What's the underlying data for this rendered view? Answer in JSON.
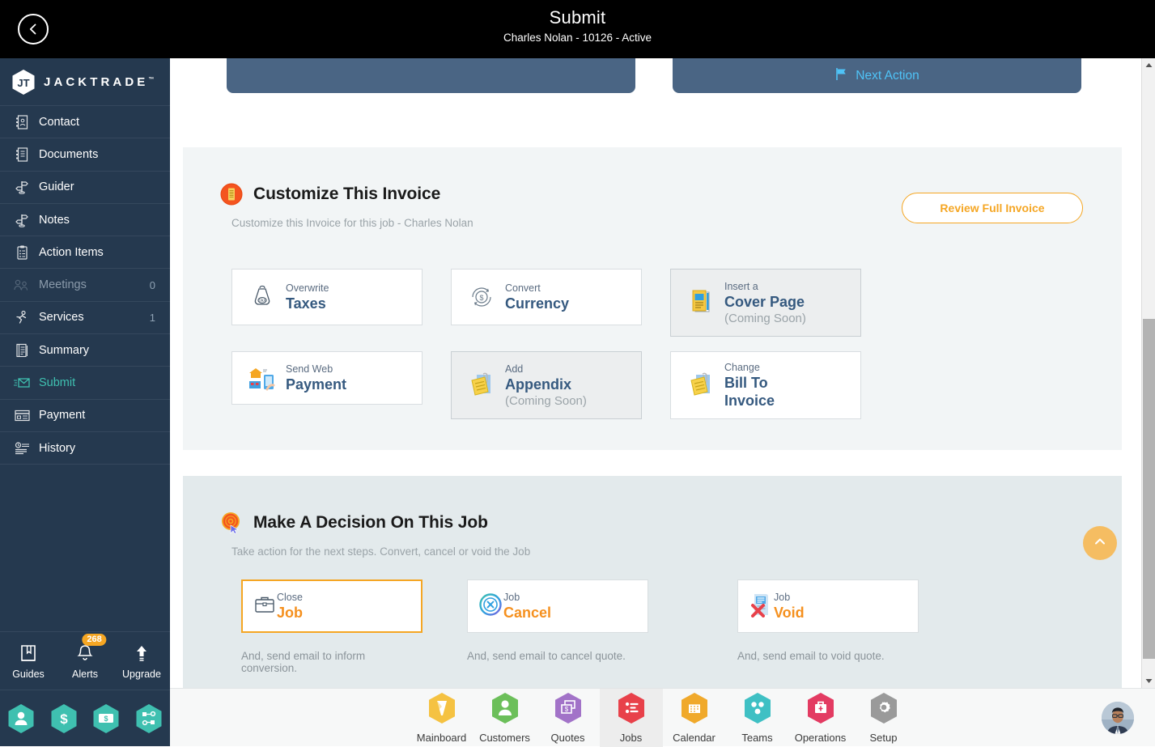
{
  "header": {
    "title": "Submit",
    "subtitle": "Charles Nolan - 10126 - Active",
    "back_icon": "chevron-left-icon"
  },
  "sidebar": {
    "brand": "JACKTRADE",
    "brand_tm": "™",
    "items": [
      {
        "label": "Contact",
        "icon": "contact-book-icon",
        "count": "",
        "state": "normal"
      },
      {
        "label": "Documents",
        "icon": "documents-icon",
        "count": "",
        "state": "normal"
      },
      {
        "label": "Guider",
        "icon": "signpost-icon",
        "count": "",
        "state": "normal"
      },
      {
        "label": "Notes",
        "icon": "signpost-icon",
        "count": "",
        "state": "normal"
      },
      {
        "label": "Action Items",
        "icon": "clipboard-icon",
        "count": "",
        "state": "normal"
      },
      {
        "label": "Meetings",
        "icon": "meetings-icon",
        "count": "0",
        "state": "dim"
      },
      {
        "label": "Services",
        "icon": "services-icon",
        "count": "1",
        "state": "normal"
      },
      {
        "label": "Summary",
        "icon": "summary-icon",
        "count": "",
        "state": "normal"
      },
      {
        "label": "Submit",
        "icon": "submit-mail-icon",
        "count": "",
        "state": "active"
      },
      {
        "label": "Payment",
        "icon": "payment-card-icon",
        "count": "",
        "state": "normal"
      },
      {
        "label": "History",
        "icon": "history-icon",
        "count": "",
        "state": "normal"
      }
    ],
    "footer": [
      {
        "label": "Guides",
        "icon": "book-icon",
        "badge": ""
      },
      {
        "label": "Alerts",
        "icon": "bell-icon",
        "badge": "268"
      },
      {
        "label": "Upgrade",
        "icon": "arrow-up-icon",
        "badge": ""
      }
    ],
    "quick_hexes": [
      {
        "icon": "person-hex-icon"
      },
      {
        "icon": "dollar-hex-icon"
      },
      {
        "icon": "money-hex-icon"
      },
      {
        "icon": "network-hex-icon"
      }
    ]
  },
  "top_strip": {
    "next_action_label": "Next Action",
    "flag_icon": "flag-icon"
  },
  "customize": {
    "icon": "orange-invoice-icon",
    "title": "Customize This Invoice",
    "subtitle": "Customize this Invoice for this job - Charles Nolan",
    "review_button": "Review Full Invoice",
    "cards": [
      {
        "small": "Overwrite",
        "big": "Taxes",
        "note": "",
        "icon": "tax-bag-icon",
        "disabled": false
      },
      {
        "small": "Convert",
        "big": "Currency",
        "note": "",
        "icon": "currency-icon",
        "disabled": false
      },
      {
        "small": "Insert a",
        "big": "Cover Page",
        "note": "(Coming Soon)",
        "icon": "cover-page-icon",
        "disabled": true
      },
      {
        "small": "Send Web",
        "big": "Payment",
        "note": "",
        "icon": "web-payment-icon",
        "disabled": false
      },
      {
        "small": "Add",
        "big": "Appendix",
        "note": "(Coming Soon)",
        "icon": "appendix-icon",
        "disabled": true
      },
      {
        "small": "Change",
        "big": "Bill To",
        "big2": "Invoice",
        "note": "",
        "icon": "appendix-icon",
        "disabled": false
      }
    ]
  },
  "decision": {
    "icon": "target-cursor-icon",
    "title": "Make A Decision On This Job",
    "subtitle": "Take action for the next steps. Convert, cancel or void the Job",
    "cards": [
      {
        "small": "Close",
        "big": "Job",
        "icon": "briefcase-icon",
        "note": "And, send email to inform conversion.",
        "highlight": true
      },
      {
        "small": "Job",
        "big": "Cancel",
        "icon": "cancel-x-icon",
        "note": "And, send email to cancel quote.",
        "highlight": false
      },
      {
        "small": "Job",
        "big": "Void",
        "icon": "void-doc-icon",
        "note": "And, send email to void quote.",
        "highlight": false
      }
    ]
  },
  "scroll_top": {
    "icon": "chevron-up-icon"
  },
  "bottom_nav": {
    "items": [
      {
        "label": "Mainboard",
        "icon": "mainboard-hex-icon",
        "color": "#f5c242",
        "selected": false
      },
      {
        "label": "Customers",
        "icon": "customers-hex-icon",
        "color": "#6cbf5a",
        "selected": false
      },
      {
        "label": "Quotes",
        "icon": "quotes-hex-icon",
        "color": "#a273c8",
        "selected": false
      },
      {
        "label": "Jobs",
        "icon": "jobs-hex-icon",
        "color": "#e8414a",
        "selected": true
      },
      {
        "label": "Calendar",
        "icon": "calendar-hex-icon",
        "color": "#f0a92b",
        "selected": false
      },
      {
        "label": "Teams",
        "icon": "teams-hex-icon",
        "color": "#3fc0c4",
        "selected": false
      },
      {
        "label": "Operations",
        "icon": "operations-hex-icon",
        "color": "#e33b62",
        "selected": false
      },
      {
        "label": "Setup",
        "icon": "setup-hex-icon",
        "color": "#9a9a9a",
        "selected": false
      }
    ],
    "avatar": "user-avatar"
  },
  "colors": {
    "sidebar_bg": "#25394f",
    "accent_orange": "#f5a623",
    "card_title_blue": "#35597f",
    "active_teal": "#3fc0b0",
    "panel1_bg": "#f2f5f6",
    "panel2_bg": "#e3eaec",
    "blue_strip": "#4a6584"
  }
}
